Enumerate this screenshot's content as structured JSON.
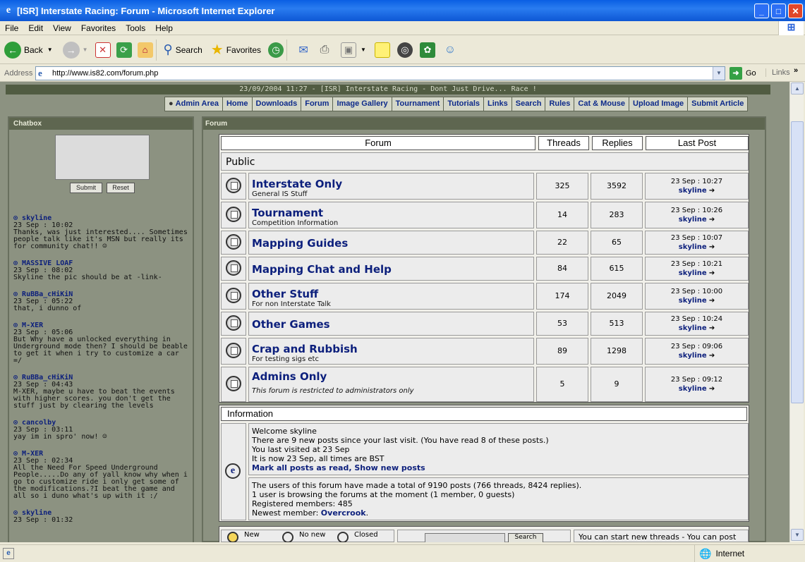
{
  "window": {
    "title": "[ISR] Interstate Racing: Forum - Microsoft Internet Explorer"
  },
  "menu": [
    "File",
    "Edit",
    "View",
    "Favorites",
    "Tools",
    "Help"
  ],
  "toolbar": {
    "back": "Back",
    "search": "Search",
    "favorites": "Favorites"
  },
  "address": {
    "label": "Address",
    "url": "http://www.is82.com/forum.php",
    "go": "Go",
    "links": "Links"
  },
  "status": {
    "zone": "Internet"
  },
  "site": {
    "topline": "23/09/2004 11:27 - [ISR] Interstate Racing - Dont Just Drive... Race !",
    "nav": [
      "Admin Area",
      "Home",
      "Downloads",
      "Forum",
      "Image Gallery",
      "Tournament",
      "Tutorials",
      "Links",
      "Search",
      "Rules",
      "Cat & Mouse",
      "Upload Image",
      "Submit Article"
    ]
  },
  "chatbox": {
    "title": "Chatbox",
    "submit": "Submit",
    "reset": "Reset",
    "messages": [
      {
        "name": "skyline",
        "time": "23 Sep : 10:02",
        "text": "Thanks, was just interested.... Sometimes people talk like it's MSN but really its for community chat!! ☺"
      },
      {
        "name": "MASSIVE LOAF",
        "time": "23 Sep : 08:02",
        "text": "Skyline the pic should be at -link-"
      },
      {
        "name": "RuBBa_cHiKiN",
        "time": "23 Sep : 05:22",
        "text": "that, i dunno of"
      },
      {
        "name": "M-XER",
        "time": "23 Sep : 05:06",
        "text": "But Why have a unlocked everything in Underground mode then? I should be beable to get it when i try to customize a car =/"
      },
      {
        "name": "RuBBa_cHiKiN",
        "time": "23 Sep : 04:43",
        "text": "M-XER, maybe u have to beat the events with higher scores. you don't get the stuff just by clearing the levels"
      },
      {
        "name": "cancolby",
        "time": "23 Sep : 03:11",
        "text": "yay im in spro' now! ☺"
      },
      {
        "name": "M-XER",
        "time": "23 Sep : 02:34",
        "text": "All the Need For Speed Underground People.....Do any of yall know why when i go to customize ride i only get some of the modifications.?I beat the game and all so i duno what's up with it :/"
      },
      {
        "name": "skyline",
        "time": "23 Sep : 01:32",
        "text": ""
      }
    ]
  },
  "forum": {
    "title": "Forum",
    "headers": {
      "forum": "Forum",
      "threads": "Threads",
      "replies": "Replies",
      "last": "Last Post"
    },
    "section": "Public",
    "rows": [
      {
        "name": "Interstate Only",
        "desc": "General IS Stuff",
        "threads": "325",
        "replies": "3592",
        "date": "23 Sep : 10:27",
        "user": "skyline"
      },
      {
        "name": "Tournament",
        "desc": "Competition Information",
        "threads": "14",
        "replies": "283",
        "date": "23 Sep : 10:26",
        "user": "skyline"
      },
      {
        "name": "Mapping Guides",
        "desc": "",
        "threads": "22",
        "replies": "65",
        "date": "23 Sep : 10:07",
        "user": "skyline"
      },
      {
        "name": "Mapping Chat and Help",
        "desc": "",
        "threads": "84",
        "replies": "615",
        "date": "23 Sep : 10:21",
        "user": "skyline"
      },
      {
        "name": "Other Stuff",
        "desc": "For non Interstate Talk",
        "threads": "174",
        "replies": "2049",
        "date": "23 Sep : 10:00",
        "user": "skyline"
      },
      {
        "name": "Other Games",
        "desc": "",
        "threads": "53",
        "replies": "513",
        "date": "23 Sep : 10:24",
        "user": "skyline"
      },
      {
        "name": "Crap and Rubbish",
        "desc": "For testing sigs etc",
        "threads": "89",
        "replies": "1298",
        "date": "23 Sep : 09:06",
        "user": "skyline"
      },
      {
        "name": "Admins Only",
        "desc": "This forum is restricted to administrators only",
        "threads": "5",
        "replies": "9",
        "date": "23 Sep : 09:12",
        "user": "skyline"
      }
    ]
  },
  "information": {
    "title": "Information",
    "lines": [
      "Welcome skyline",
      "There are 9 new posts since your last visit. (You have read 8 of these posts.)",
      "You last visited at 23 Sep",
      "It is now 23 Sep, all times are BST"
    ],
    "mark_read": "Mark all posts as read",
    "show_new": "Show new posts",
    "stats": [
      "The users of this forum have made a total of 9190 posts (766 threads, 8424 replies).",
      "1 user is browsing the forums at the moment (1 member, 0 guests)",
      "Registered members: 485"
    ],
    "newest_label": "Newest member:",
    "newest_member": "Overcrook"
  },
  "legend": {
    "new": "New",
    "no_new": "No new",
    "closed": "Closed",
    "search": "Search",
    "permissions": "You can start new threads - You can post"
  }
}
